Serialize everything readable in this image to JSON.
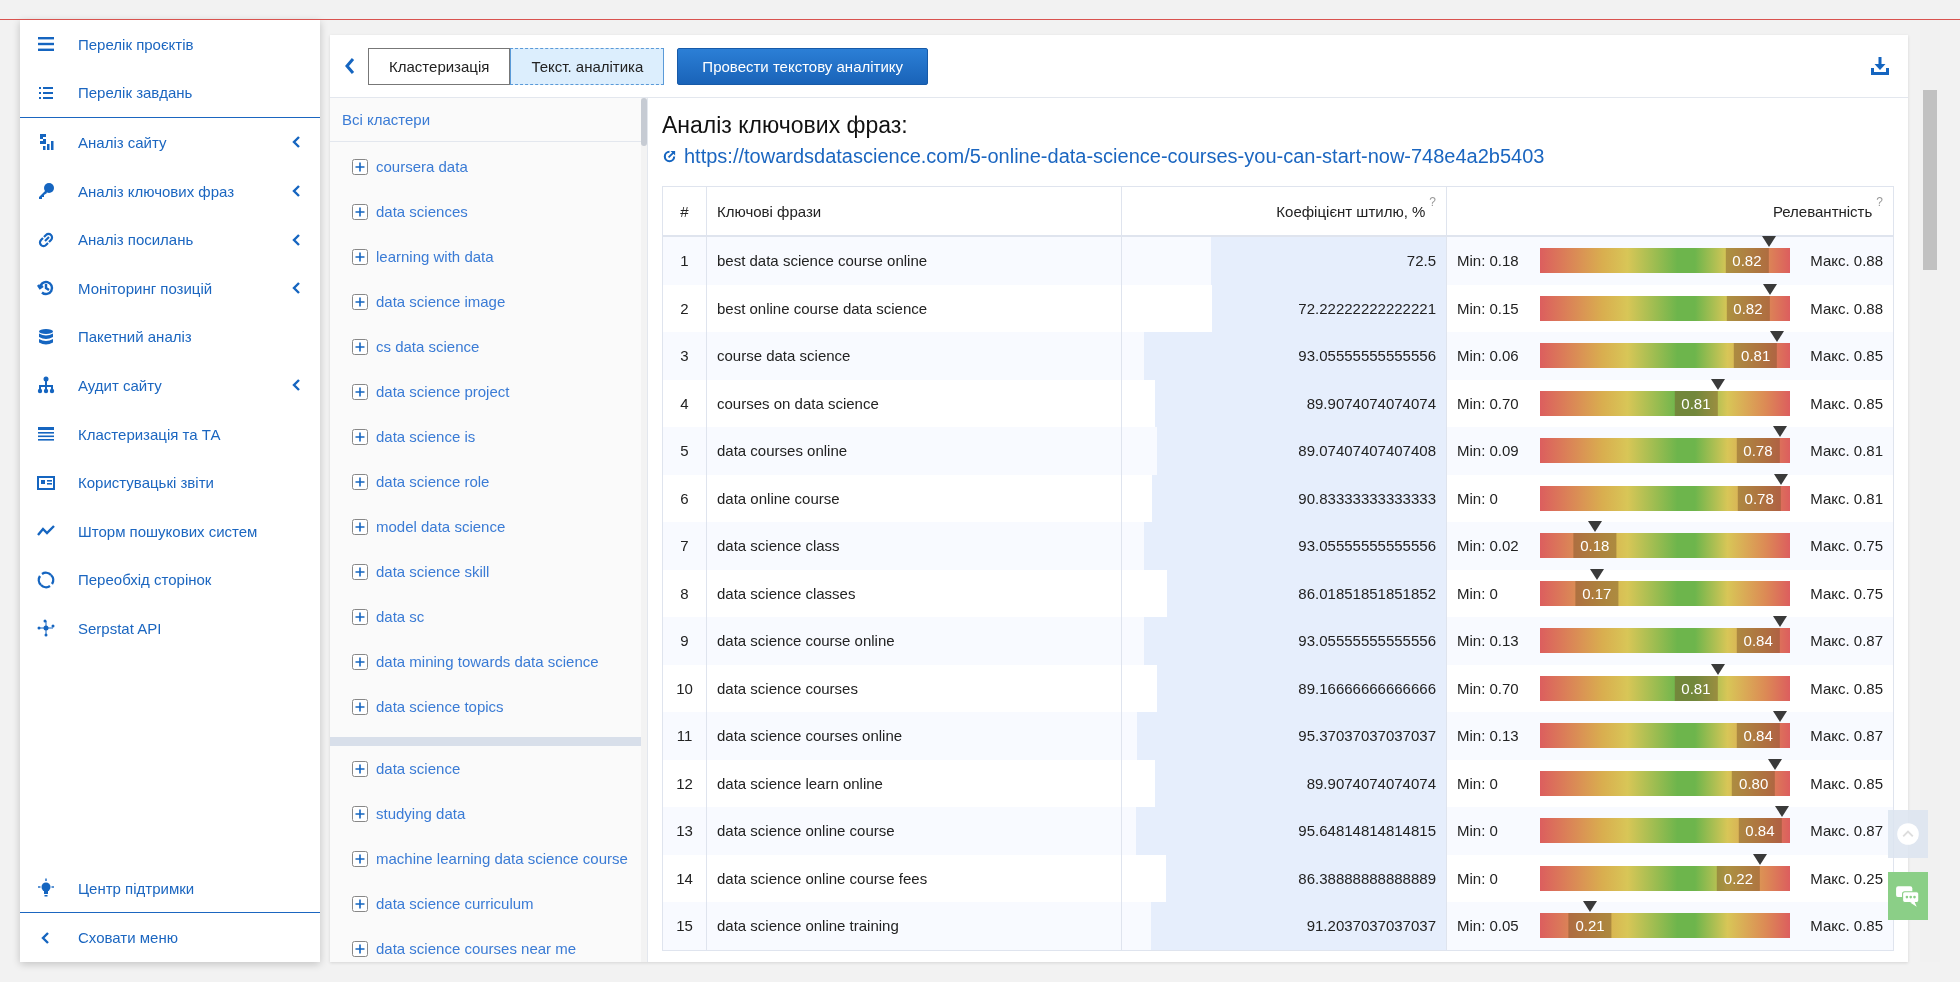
{
  "sidebar": {
    "top_items": [
      {
        "label": "Перелік проєктів",
        "submenu": false
      },
      {
        "label": "Перелік завдань",
        "submenu": false
      }
    ],
    "items": [
      {
        "label": "Аналіз сайту",
        "submenu": true
      },
      {
        "label": "Аналіз ключових фраз",
        "submenu": true
      },
      {
        "label": "Аналіз посилань",
        "submenu": true
      },
      {
        "label": "Моніторинг позицій",
        "submenu": true
      },
      {
        "label": "Пакетний аналіз",
        "submenu": false
      },
      {
        "label": "Аудит сайту",
        "submenu": true
      },
      {
        "label": "Кластеризація та ТА",
        "submenu": false
      },
      {
        "label": "Користувацькі звіти",
        "submenu": false
      },
      {
        "label": "Шторм пошукових систем",
        "submenu": false
      },
      {
        "label": "Переобхід сторінок",
        "submenu": false
      },
      {
        "label": "Serpstat API",
        "submenu": false
      }
    ],
    "support": "Центр підтримки",
    "hide": "Сховати меню"
  },
  "toolbar": {
    "tabs": [
      {
        "label": "Кластеризація",
        "selected": false
      },
      {
        "label": "Текст. аналітика",
        "selected": true
      }
    ],
    "action": "Провести текстову аналітику"
  },
  "clusters": {
    "all": "Всі кластери",
    "groups": [
      {
        "items": [
          "coursera data",
          "data sciences",
          "learning with data",
          "data science image",
          "cs data science",
          "data science project",
          "data science is",
          "data science role",
          "model data science",
          "data science skill",
          "data sc",
          "data mining towards data science",
          "data science topics"
        ]
      },
      {
        "items": [
          "data science",
          "studying data",
          "machine learning data science course",
          "data science curriculum",
          "data science courses near me"
        ]
      }
    ]
  },
  "analysis": {
    "title": "Аналіз ключових фраз:",
    "url": "https://towardsdatascience.com/5-online-data-science-courses-you-can-start-now-748e4a2b5403",
    "table": {
      "columns": [
        {
          "label": "#"
        },
        {
          "label": "Ключові фрази"
        },
        {
          "label": "Коефіцієнт штилю, %",
          "help": "?"
        },
        {
          "label": "Релевантність",
          "help": "?"
        }
      ],
      "rows": [
        {
          "num": "1",
          "phrase": "best data science course online",
          "coef": {
            "text": "72.5",
            "level": 0.725
          },
          "min": "Min: 0.18",
          "value": "0.82",
          "level": 0.914,
          "max": "Макс. 0.88"
        },
        {
          "num": "2",
          "phrase": "best online course data science",
          "coef": {
            "text": "72.22222222222221",
            "level": 0.722
          },
          "min": "Min: 0.15",
          "value": "0.82",
          "level": 0.918,
          "max": "Макс. 0.88"
        },
        {
          "num": "3",
          "phrase": "course data science",
          "coef": {
            "text": "93.05555555555556",
            "level": 0.931
          },
          "min": "Min: 0.06",
          "value": "0.81",
          "level": 0.949,
          "max": "Макс. 0.85"
        },
        {
          "num": "4",
          "phrase": "courses on data science",
          "coef": {
            "text": "89.9074074074074",
            "level": 0.899
          },
          "min": "Min: 0.70",
          "value": "0.81",
          "level": 0.71,
          "max": "Макс. 0.85"
        },
        {
          "num": "5",
          "phrase": "data courses online",
          "coef": {
            "text": "89.07407407407408",
            "level": 0.891
          },
          "min": "Min: 0.09",
          "value": "0.78",
          "level": 0.958,
          "max": "Макс. 0.81"
        },
        {
          "num": "6",
          "phrase": "data online course",
          "coef": {
            "text": "90.83333333333333",
            "level": 0.908
          },
          "min": "Min: 0",
          "value": "0.78",
          "level": 0.963,
          "max": "Макс. 0.81"
        },
        {
          "num": "7",
          "phrase": "data science class",
          "coef": {
            "text": "93.05555555555556",
            "level": 0.931
          },
          "min": "Min: 0.02",
          "value": "0.18",
          "level": 0.219,
          "max": "Макс. 0.75"
        },
        {
          "num": "8",
          "phrase": "data science classes",
          "coef": {
            "text": "86.01851851851852",
            "level": 0.86
          },
          "min": "Min: 0",
          "value": "0.17",
          "level": 0.227,
          "max": "Макс. 0.75"
        },
        {
          "num": "9",
          "phrase": "data science course online",
          "coef": {
            "text": "93.05555555555556",
            "level": 0.931
          },
          "min": "Min: 0.13",
          "value": "0.84",
          "level": 0.959,
          "max": "Макс. 0.87"
        },
        {
          "num": "10",
          "phrase": "data science courses",
          "coef": {
            "text": "89.16666666666666",
            "level": 0.892
          },
          "min": "Min: 0.70",
          "value": "0.81",
          "level": 0.71,
          "max": "Макс. 0.85"
        },
        {
          "num": "11",
          "phrase": "data science courses online",
          "coef": {
            "text": "95.37037037037037",
            "level": 0.954
          },
          "min": "Min: 0.13",
          "value": "0.84",
          "level": 0.959,
          "max": "Макс. 0.87"
        },
        {
          "num": "12",
          "phrase": "data science learn online",
          "coef": {
            "text": "89.9074074074074",
            "level": 0.899
          },
          "min": "Min: 0",
          "value": "0.80",
          "level": 0.941,
          "max": "Макс. 0.85"
        },
        {
          "num": "13",
          "phrase": "data science online course",
          "coef": {
            "text": "95.64814814814815",
            "level": 0.956
          },
          "min": "Min: 0",
          "value": "0.84",
          "level": 0.966,
          "max": "Макс. 0.87"
        },
        {
          "num": "14",
          "phrase": "data science online course fees",
          "coef": {
            "text": "86.38888888888889",
            "level": 0.864
          },
          "min": "Min: 0",
          "value": "0.22",
          "level": 0.88,
          "max": "Макс. 0.25"
        },
        {
          "num": "15",
          "phrase": "data science online training",
          "coef": {
            "text": "91.2037037037037",
            "level": 0.912
          },
          "min": "Min: 0.05",
          "value": "0.21",
          "level": 0.2,
          "max": "Макс. 0.85"
        }
      ]
    }
  }
}
